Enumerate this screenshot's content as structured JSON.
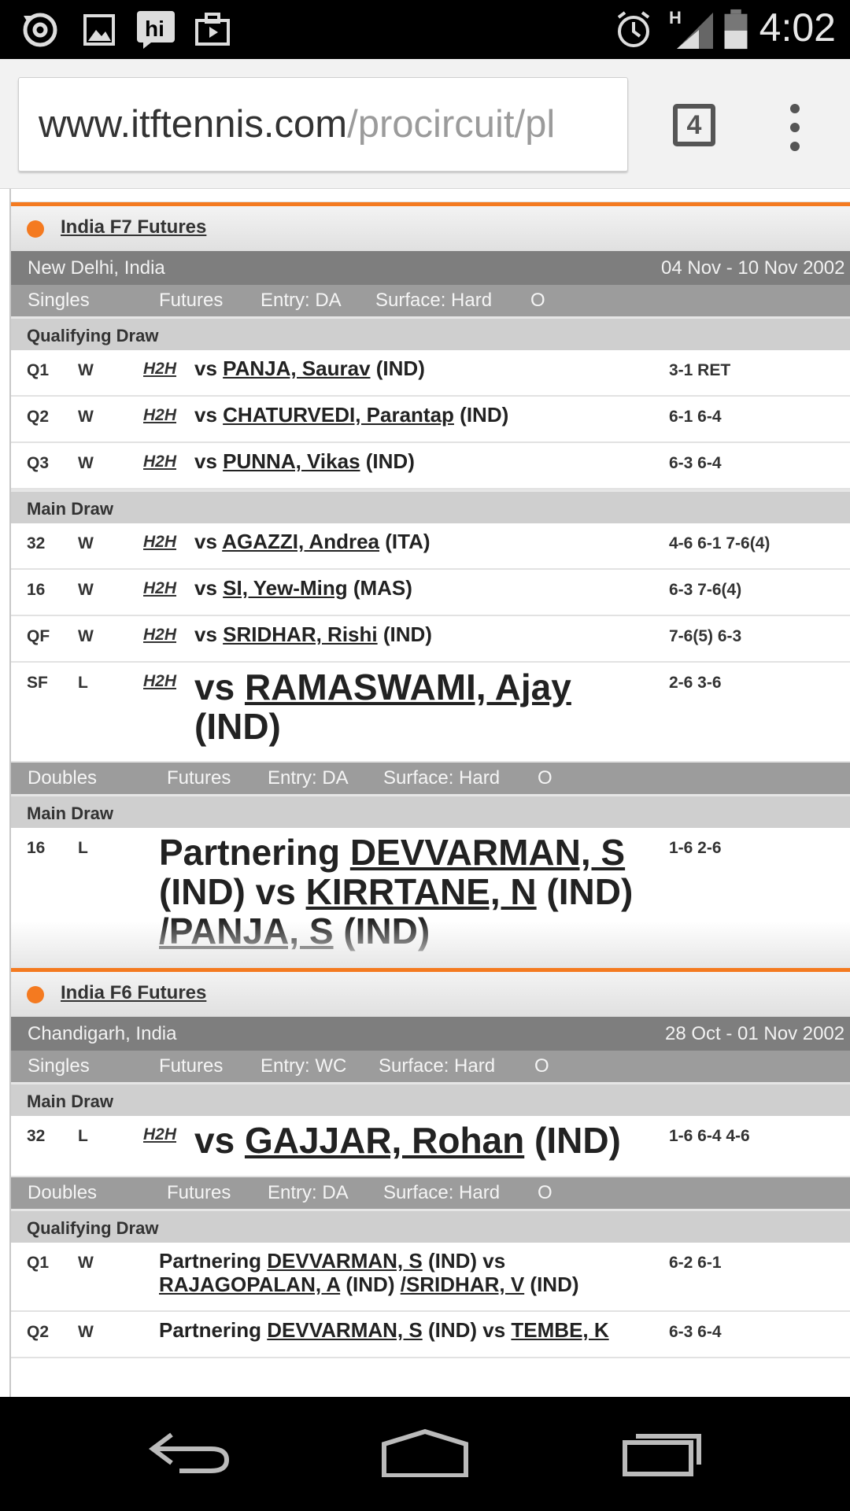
{
  "status_bar": {
    "time": "4:02",
    "network": "H",
    "icons": [
      "sync-icon",
      "gallery-icon",
      "hike-messenger-icon",
      "briefcase-icon",
      "alarm-icon",
      "signal-icon",
      "battery-icon"
    ]
  },
  "browser": {
    "url_domain": "www.itftennis.com",
    "url_path": "/procircuit/pl",
    "tab_count": "4"
  },
  "tournaments": [
    {
      "name": "India F7 Futures",
      "location": "New Delhi, India",
      "dates": "04 Nov - 10 Nov 2002",
      "events": [
        {
          "event": {
            "type": "Singles",
            "level": "Futures",
            "entry": "Entry: DA",
            "surface": "Surface: Hard",
            "io": "O"
          },
          "draws": [
            {
              "title": "Qualifying Draw",
              "matches": [
                {
                  "round": "Q1",
                  "result": "W",
                  "h2h": "H2H",
                  "vs": "vs",
                  "opponent": "PANJA, Saurav",
                  "country": "(IND)",
                  "score": "3-1 RET"
                },
                {
                  "round": "Q2",
                  "result": "W",
                  "h2h": "H2H",
                  "vs": "vs",
                  "opponent": "CHATURVEDI, Parantap",
                  "country": "(IND)",
                  "score": "6-1 6-4"
                },
                {
                  "round": "Q3",
                  "result": "W",
                  "h2h": "H2H",
                  "vs": "vs",
                  "opponent": "PUNNA, Vikas",
                  "country": "(IND)",
                  "score": "6-3 6-4"
                }
              ]
            },
            {
              "title": "Main Draw",
              "matches": [
                {
                  "round": "32",
                  "result": "W",
                  "h2h": "H2H",
                  "vs": "vs",
                  "opponent": "AGAZZI, Andrea",
                  "country": "(ITA)",
                  "score": "4-6 6-1 7-6(4)"
                },
                {
                  "round": "16",
                  "result": "W",
                  "h2h": "H2H",
                  "vs": "vs",
                  "opponent": "SI, Yew-Ming",
                  "country": "(MAS)",
                  "score": "6-3 7-6(4)"
                },
                {
                  "round": "QF",
                  "result": "W",
                  "h2h": "H2H",
                  "vs": "vs",
                  "opponent": "SRIDHAR, Rishi",
                  "country": "(IND)",
                  "score": "7-6(5) 6-3"
                },
                {
                  "round": "SF",
                  "result": "L",
                  "h2h": "H2H",
                  "vs": "vs",
                  "opponent": "RAMASWAMI, Ajay",
                  "country": "(IND)",
                  "score": "2-6 3-6"
                }
              ]
            }
          ]
        },
        {
          "event": {
            "type": "Doubles",
            "level": "Futures",
            "entry": "Entry: DA",
            "surface": "Surface: Hard",
            "io": "O"
          },
          "draws": [
            {
              "title": "Main Draw",
              "matches": [
                {
                  "round": "16",
                  "result": "L",
                  "partnering": "Partnering",
                  "partner": "DEVVARMAN, S",
                  "partner_country": "(IND)",
                  "vs": "vs",
                  "opponent1": "KIRRTANE, N",
                  "country1": "(IND)",
                  "opponent2": "/PANJA, S",
                  "country2": "(IND)",
                  "score": "1-6 2-6"
                }
              ]
            }
          ]
        }
      ]
    },
    {
      "name": "India F6 Futures",
      "location": "Chandigarh, India",
      "dates": "28 Oct - 01 Nov 2002",
      "events": [
        {
          "event": {
            "type": "Singles",
            "level": "Futures",
            "entry": "Entry: WC",
            "surface": "Surface: Hard",
            "io": "O"
          },
          "draws": [
            {
              "title": "Main Draw",
              "matches": [
                {
                  "round": "32",
                  "result": "L",
                  "h2h": "H2H",
                  "vs": "vs",
                  "opponent": "GAJJAR, Rohan",
                  "country": "(IND)",
                  "score": "1-6 6-4 4-6"
                }
              ]
            }
          ]
        },
        {
          "event": {
            "type": "Doubles",
            "level": "Futures",
            "entry": "Entry: DA",
            "surface": "Surface: Hard",
            "io": "O"
          },
          "draws": [
            {
              "title": "Qualifying Draw",
              "matches": [
                {
                  "round": "Q1",
                  "result": "W",
                  "partnering": "Partnering",
                  "partner": "DEVVARMAN, S",
                  "partner_country": "(IND)",
                  "vs": "vs",
                  "opponent1": "RAJAGOPALAN, A",
                  "country1": "(IND)",
                  "opponent2": "/SRIDHAR, V",
                  "country2": "(IND)",
                  "score": "6-2 6-1"
                },
                {
                  "round": "Q2",
                  "result": "W",
                  "partnering": "Partnering",
                  "partner": "DEVVARMAN, S",
                  "partner_country": "(IND)",
                  "vs": "vs",
                  "opponent1": "TEMBE, K",
                  "score": "6-3 6-4"
                }
              ]
            }
          ]
        }
      ]
    }
  ],
  "colors": {
    "accent": "#f47a20",
    "location_bar": "#7e7e7e",
    "event_bar": "#9c9c9c",
    "draw_header": "#cfcfcf"
  }
}
